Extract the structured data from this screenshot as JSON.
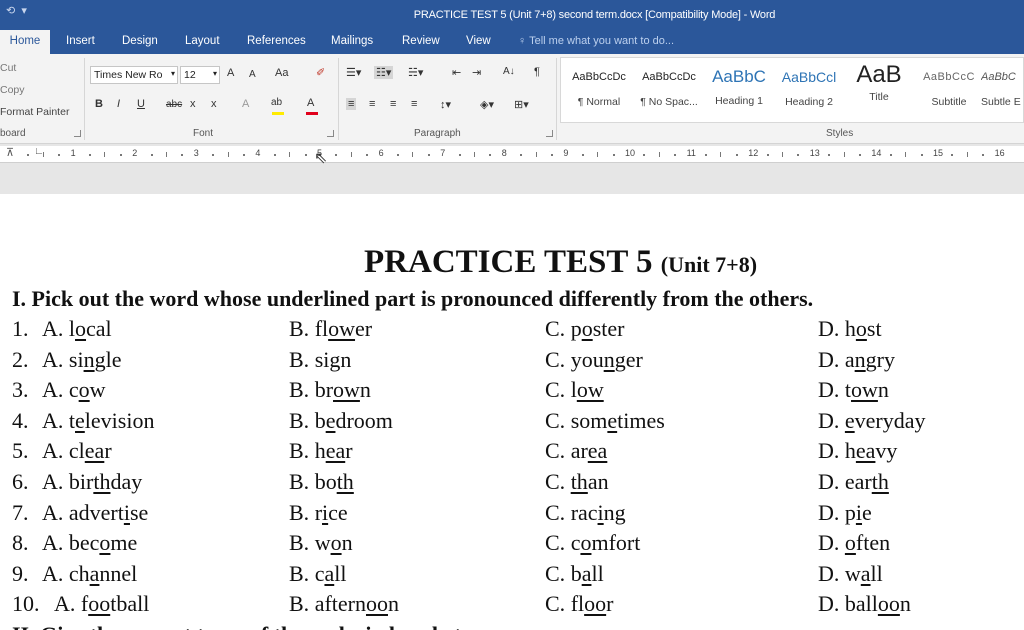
{
  "window": {
    "title": "PRACTICE TEST 5 (Unit 7+8) second term.docx [Compatibility Mode] - Word"
  },
  "tabs": [
    "Home",
    "Insert",
    "Design",
    "Layout",
    "References",
    "Mailings",
    "Review",
    "View"
  ],
  "tell_me": "Tell me what you want to do...",
  "clipboard": {
    "cut": "Cut",
    "copy": "Copy",
    "format_painter": "Format Painter",
    "label": "board"
  },
  "font": {
    "name": "Times New Ro",
    "size": "12",
    "grow": "A",
    "shrink": "A",
    "case": "Aa",
    "bold": "B",
    "italic": "I",
    "underline": "U",
    "strike": "abc",
    "subscript": "x",
    "superscript": "x",
    "effects": "A",
    "highlight": "ab",
    "color": "A",
    "label": "Font",
    "highlight_color": "#ffeb00",
    "font_color": "#e0001b"
  },
  "paragraph": {
    "label": "Paragraph",
    "sort": "A↓",
    "pilcrow": "¶"
  },
  "styles": {
    "label": "Styles",
    "items": [
      {
        "preview": "AaBbCcDc",
        "name": "¶ Normal"
      },
      {
        "preview": "AaBbCcDc",
        "name": "¶ No Spac..."
      },
      {
        "preview": "AaBbC",
        "name": "Heading 1"
      },
      {
        "preview": "AaBbCcl",
        "name": "Heading 2"
      },
      {
        "preview": "AaB",
        "name": "Title"
      },
      {
        "preview": "AaBbCcC",
        "name": "Subtitle"
      },
      {
        "preview": "AaBbC",
        "name": "Subtle E"
      }
    ]
  },
  "ruler": {
    "numbers": [
      "1",
      "2",
      "3",
      "4",
      "5",
      "6",
      "7",
      "8",
      "9",
      "10",
      "11",
      "12",
      "13",
      "14",
      "15",
      "16"
    ]
  },
  "document": {
    "title_main": "PRACTICE TEST 5",
    "title_sub": "(Unit 7+8)",
    "instruction": "I. Pick out the word whose underlined part is pronounced differently from the others.",
    "questions": [
      {
        "n": "1.",
        "opts": [
          {
            "letter": "A.",
            "pre": "l",
            "u": "o",
            "post": "cal"
          },
          {
            "letter": "B.",
            "pre": "fl",
            "u": "ow",
            "post": "er"
          },
          {
            "letter": "C.",
            "pre": "p",
            "u": "o",
            "post": "ster"
          },
          {
            "letter": "D.",
            "pre": "h",
            "u": "o",
            "post": "st"
          }
        ]
      },
      {
        "n": "2.",
        "opts": [
          {
            "letter": "A.",
            "pre": "si",
            "u": "n",
            "post": "gle"
          },
          {
            "letter": "B.",
            "pre": "si",
            "u": "g",
            "post": "n"
          },
          {
            "letter": "C.",
            "pre": "you",
            "u": "n",
            "post": "ger"
          },
          {
            "letter": "D.",
            "pre": "a",
            "u": "n",
            "post": "gry"
          }
        ]
      },
      {
        "n": "3.",
        "opts": [
          {
            "letter": "A.",
            "pre": "c",
            "u": "o",
            "post": "w"
          },
          {
            "letter": "B.",
            "pre": "br",
            "u": "ow",
            "post": "n"
          },
          {
            "letter": "C.",
            "pre": "l",
            "u": "ow",
            "post": ""
          },
          {
            "letter": "D.",
            "pre": "t",
            "u": "ow",
            "post": "n"
          }
        ]
      },
      {
        "n": "4.",
        "opts": [
          {
            "letter": "A.",
            "pre": "t",
            "u": "e",
            "post": "levision"
          },
          {
            "letter": "B.",
            "pre": "b",
            "u": "e",
            "post": "droom"
          },
          {
            "letter": "C.",
            "pre": "som",
            "u": "e",
            "post": "times"
          },
          {
            "letter": "D.",
            "pre": "",
            "u": "e",
            "post": "veryday"
          }
        ]
      },
      {
        "n": "5.",
        "opts": [
          {
            "letter": "A.",
            "pre": "cl",
            "u": "ea",
            "post": "r"
          },
          {
            "letter": "B.",
            "pre": "h",
            "u": "ea",
            "post": "r"
          },
          {
            "letter": "C.",
            "pre": "ar",
            "u": "ea",
            "post": ""
          },
          {
            "letter": "D.",
            "pre": "h",
            "u": "ea",
            "post": "vy"
          }
        ]
      },
      {
        "n": "6.",
        "opts": [
          {
            "letter": "A.",
            "pre": "bir",
            "u": "th",
            "post": "day"
          },
          {
            "letter": "B.",
            "pre": "bo",
            "u": "th",
            "post": ""
          },
          {
            "letter": "C.",
            "pre": "",
            "u": "th",
            "post": "an"
          },
          {
            "letter": "D.",
            "pre": "ear",
            "u": "th",
            "post": ""
          }
        ]
      },
      {
        "n": "7.",
        "opts": [
          {
            "letter": "A.",
            "pre": "advert",
            "u": "i",
            "post": "se"
          },
          {
            "letter": "B.",
            "pre": "r",
            "u": "i",
            "post": "ce"
          },
          {
            "letter": "C.",
            "pre": "rac",
            "u": "i",
            "post": "ng"
          },
          {
            "letter": "D.",
            "pre": "p",
            "u": "i",
            "post": "e"
          }
        ]
      },
      {
        "n": "8.",
        "opts": [
          {
            "letter": "A.",
            "pre": "bec",
            "u": "o",
            "post": "me"
          },
          {
            "letter": "B.",
            "pre": "w",
            "u": "o",
            "post": "n"
          },
          {
            "letter": "C.",
            "pre": "c",
            "u": "o",
            "post": "mfort"
          },
          {
            "letter": "D.",
            "pre": "",
            "u": "o",
            "post": "ften"
          }
        ]
      },
      {
        "n": "9.",
        "opts": [
          {
            "letter": "A.",
            "pre": "ch",
            "u": "a",
            "post": "nnel"
          },
          {
            "letter": "B.",
            "pre": "c",
            "u": "a",
            "post": "ll"
          },
          {
            "letter": "C.",
            "pre": "b",
            "u": "a",
            "post": "ll"
          },
          {
            "letter": "D.",
            "pre": "w",
            "u": "a",
            "post": "ll"
          }
        ]
      },
      {
        "n": "10.",
        "opts": [
          {
            "letter": "A.",
            "pre": "f",
            "u": "oo",
            "post": "tball"
          },
          {
            "letter": "B.",
            "pre": "aftern",
            "u": "oo",
            "post": "n"
          },
          {
            "letter": "C.",
            "pre": "fl",
            "u": "oo",
            "post": "r"
          },
          {
            "letter": "D.",
            "pre": "ball",
            "u": "oo",
            "post": "n"
          }
        ]
      }
    ],
    "next_section": "II. Give the correct tense of the verbs in brackets."
  }
}
